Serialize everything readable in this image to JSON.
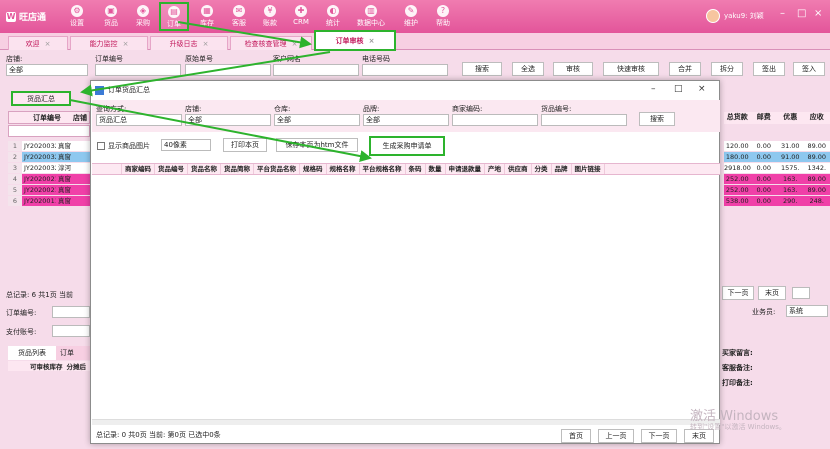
{
  "app": {
    "logo": "旺店通"
  },
  "nav": [
    {
      "label": "设置",
      "icon": "gear-icon"
    },
    {
      "label": "货品",
      "icon": "goods-icon"
    },
    {
      "label": "采购",
      "icon": "purchase-icon"
    },
    {
      "label": "订单",
      "icon": "order-icon"
    },
    {
      "label": "库存",
      "icon": "stock-icon"
    },
    {
      "label": "客服",
      "icon": "service-icon"
    },
    {
      "label": "账款",
      "icon": "account-icon"
    },
    {
      "label": "CRM",
      "icon": "crm-icon"
    },
    {
      "label": "统计",
      "icon": "stats-icon"
    },
    {
      "label": "数据中心",
      "icon": "data-icon"
    },
    {
      "label": "维护",
      "icon": "maintain-icon"
    },
    {
      "label": "帮助",
      "icon": "help-icon"
    }
  ],
  "user": {
    "name": "yaku9: 刘颖"
  },
  "tabs": [
    "欢迎",
    "能力监控",
    "升级日志",
    "检查核查管理",
    "订单审核"
  ],
  "main": {
    "shop_label": "店铺:",
    "shop_value": "全部",
    "order_no_label": "订单编号",
    "orig_no_label": "原始单号",
    "customer_label": "客户网名",
    "phone_label": "电话号码",
    "buttons": [
      "搜索",
      "全选",
      "审核",
      "快速审核",
      "合并",
      "拆分",
      "签出",
      "签入"
    ],
    "goods_summary_btn": "货品汇总",
    "grid_cols": [
      "订单编号",
      "店铺"
    ],
    "rows": [
      {
        "n": "1",
        "id": "JY2020032",
        "shop": "真窗"
      },
      {
        "n": "2",
        "id": "JY2020032",
        "shop": "真窗"
      },
      {
        "n": "3",
        "id": "JY2020032",
        "shop": "淳河"
      },
      {
        "n": "4",
        "id": "JY2020021",
        "shop": "真窗"
      },
      {
        "n": "5",
        "id": "JY2020021",
        "shop": "真窗"
      },
      {
        "n": "6",
        "id": "JY2020011",
        "shop": "真窗"
      }
    ],
    "right_cols": [
      "总货款",
      "邮费",
      "优惠",
      "应收"
    ],
    "right_rows": [
      [
        "120.00",
        "0.00",
        "31.00",
        "89.00"
      ],
      [
        "180.00",
        "0.00",
        "91.00",
        "89.00"
      ],
      [
        "2918.00",
        "0.00",
        "1575.",
        "1342."
      ],
      [
        "252.00",
        "0.00",
        "163.",
        "89.00"
      ],
      [
        "252.00",
        "0.00",
        "163.",
        "89.00"
      ],
      [
        "538.00",
        "0.00",
        "290.",
        "248."
      ]
    ],
    "footer": "总记录: 6  共1页  当前",
    "order_no_field": "订单编号:",
    "pay_account": "支付账号:",
    "bottom_tabs": [
      "货品列表",
      "订单"
    ],
    "bottom_cols": [
      "可审核库存",
      "分摊后"
    ],
    "pager": [
      "下一页",
      "末页"
    ],
    "salesman_label": "业务员:",
    "salesman_value": "系统",
    "notes": [
      "买家留言:",
      "客服备注:",
      "打印备注:"
    ]
  },
  "dialog": {
    "title": "订单货品汇总",
    "query_label": "查询方式:",
    "query_value": "货品汇总",
    "shop_label": "店铺:",
    "shop_value": "全部",
    "warehouse_label": "仓库:",
    "warehouse_value": "全部",
    "brand_label": "品牌:",
    "brand_value": "全部",
    "merchant_code_label": "商家编码:",
    "goods_no_label": "货品编号:",
    "search_btn": "搜索",
    "show_image": "显示商品图片",
    "pixel_value": "40像素",
    "print_btn": "打印本页",
    "save_btn": "保存本页为htm文件",
    "gen_btn": "生成采购申请单",
    "columns": [
      "商家编码",
      "货品编号",
      "货品名称",
      "货品简称",
      "平台货品名称",
      "规格码",
      "规格名称",
      "平台规格名称",
      "条码",
      "数量",
      "申请退款量",
      "产地",
      "供应商",
      "分类",
      "品牌",
      "图片链接"
    ],
    "footer": "总记录: 0  共0页  当前: 第0页  已选中0条",
    "pager": [
      "首页",
      "上一页",
      "下一页",
      "末页"
    ]
  },
  "watermark": {
    "line1": "激活 Windows",
    "line2": "转到\"设置\"以激活 Windows。"
  }
}
